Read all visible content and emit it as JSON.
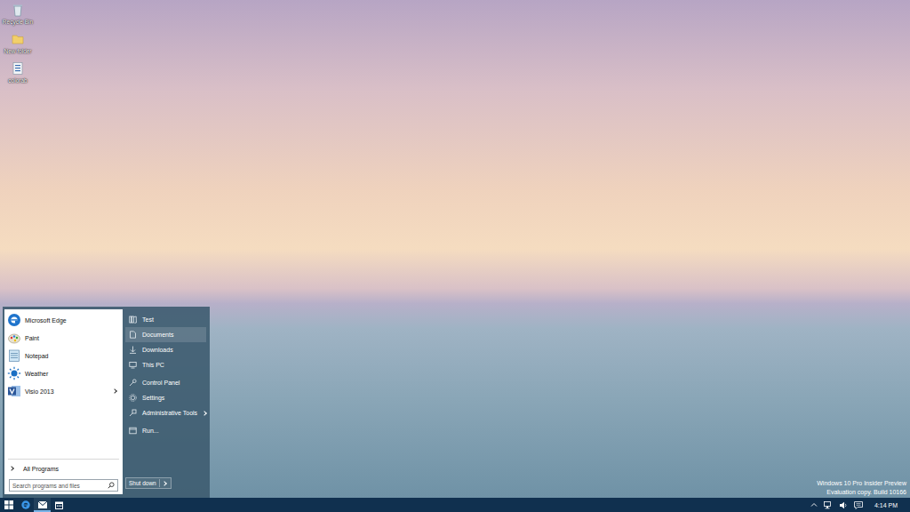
{
  "desktop_icons": [
    {
      "label": "Recycle Bin"
    },
    {
      "label": "New folder"
    },
    {
      "label": "colorab"
    }
  ],
  "start_menu": {
    "pinned": [
      {
        "label": "Microsoft Edge",
        "submenu": false
      },
      {
        "label": "Paint",
        "submenu": false
      },
      {
        "label": "Notepad",
        "submenu": false
      },
      {
        "label": "Weather",
        "submenu": false
      },
      {
        "label": "Visio 2013",
        "submenu": true
      }
    ],
    "all_programs": {
      "label": "All Programs"
    },
    "search": {
      "placeholder": "Search programs and files"
    },
    "places": [
      {
        "label": "Test",
        "selected": false,
        "submenu": false
      },
      {
        "label": "Documents",
        "selected": true,
        "submenu": false
      },
      {
        "label": "Downloads",
        "selected": false,
        "submenu": false
      },
      {
        "label": "This PC",
        "selected": false,
        "submenu": false
      },
      {
        "label": "Control Panel",
        "selected": false,
        "submenu": false
      },
      {
        "label": "Settings",
        "selected": false,
        "submenu": false
      },
      {
        "label": "Administrative Tools",
        "selected": false,
        "submenu": true
      },
      {
        "label": "Run...",
        "selected": false,
        "submenu": false
      }
    ],
    "shutdown": {
      "label": "Shut down"
    }
  },
  "watermark": [
    "Windows 10 Pro Insider Preview",
    "Evaluation copy. Build 10166"
  ],
  "taskbar": {
    "clock": "4:14 PM"
  }
}
